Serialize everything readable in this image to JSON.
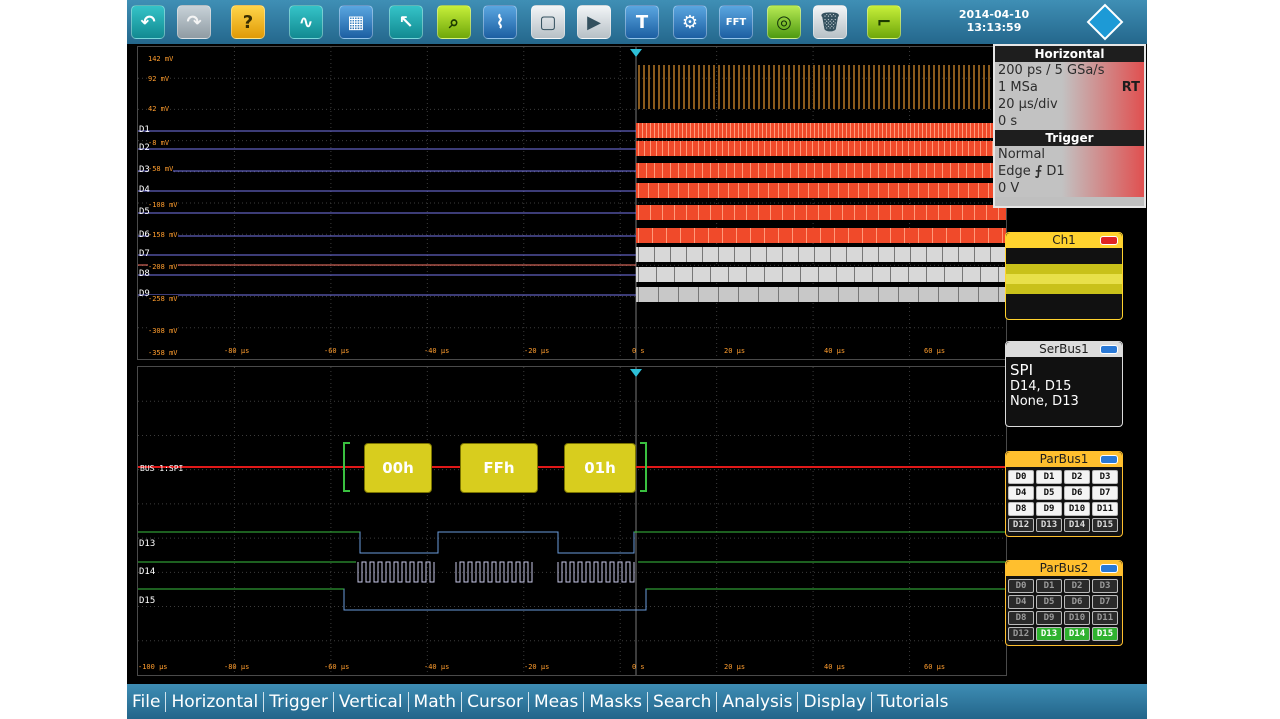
{
  "toolbar": {
    "buttons": [
      {
        "icon": "undo-arrow-icon",
        "glyph": "↶",
        "style": "tb-teal"
      },
      {
        "icon": "redo-arrow-icon",
        "glyph": "↷",
        "style": "tb-grey"
      },
      {
        "icon": "help-icon",
        "glyph": "?",
        "style": "tb-yellow"
      },
      {
        "icon": "autoset-icon",
        "glyph": "∿",
        "style": "tb-teal"
      },
      {
        "icon": "grid-layout-icon",
        "glyph": "▦",
        "style": "tb-blue"
      },
      {
        "icon": "pointer-icon",
        "glyph": "↖",
        "style": "tb-teal"
      },
      {
        "icon": "zoom-pointer-icon",
        "glyph": "⌕",
        "style": "tb-lime"
      },
      {
        "icon": "measure-icon",
        "glyph": "⌇",
        "style": "tb-blue"
      },
      {
        "icon": "window-icon",
        "glyph": "▢",
        "style": "tb-white"
      },
      {
        "icon": "flag-icon",
        "glyph": "▶",
        "style": "tb-white"
      },
      {
        "icon": "text-cursor-icon",
        "glyph": "T",
        "style": "tb-blue"
      },
      {
        "icon": "settings-window-icon",
        "glyph": "⚙",
        "style": "tb-blue"
      },
      {
        "icon": "fft-icon",
        "glyph": "FFT",
        "style": "tb-blue"
      },
      {
        "icon": "scope-icon",
        "glyph": "◎",
        "style": "tb-green"
      },
      {
        "icon": "trash-icon",
        "glyph": "🗑",
        "style": "tb-white"
      },
      {
        "icon": "waveform-icon",
        "glyph": "⌐",
        "style": "tb-lime"
      }
    ],
    "date": "2014-04-10",
    "time": "13:13:59"
  },
  "top_pane": {
    "levels": [
      "142 mV",
      "92 mV",
      "42 mV",
      "-8 mV",
      "-58 mV",
      "-108 mV",
      "-158 mV",
      "-208 mV",
      "-258 mV",
      "-308 mV",
      "-358 mV"
    ],
    "channels": [
      "D1",
      "D2",
      "D3",
      "D4",
      "D5",
      "D6",
      "D7",
      "D8",
      "D9"
    ],
    "time_ticks": [
      "-80 µs",
      "-60 µs",
      "-40 µs",
      "-20 µs",
      "0 s",
      "20 µs",
      "40 µs",
      "60 µs"
    ]
  },
  "bottom_pane": {
    "bus_label": "BUS 1:SPI",
    "bus_values": [
      "00h",
      "FFh",
      "01h"
    ],
    "channels": [
      "D13",
      "D14",
      "D15"
    ],
    "time_ticks": [
      "-100 µs",
      "-80 µs",
      "-60 µs",
      "-40 µs",
      "-20 µs",
      "0 s",
      "20 µs",
      "40 µs",
      "60 µs",
      "80 µs",
      "100 µs"
    ]
  },
  "horizontal": {
    "title": "Horizontal",
    "resolution": "200 ps / 5 GSa/s",
    "record_length": "1 MSa",
    "mode": "RT",
    "time_scale": "20 µs/div",
    "position": "0 s"
  },
  "trigger": {
    "title": "Trigger",
    "mode": "Normal",
    "type_prefix": "Edge",
    "source": "D1",
    "level": "0 V"
  },
  "ch1": {
    "title": "Ch1"
  },
  "serbus": {
    "title": "SerBus1",
    "protocol": "SPI",
    "line1": "D14, D15",
    "line2": "None, D13"
  },
  "parbus1": {
    "title": "ParBus1",
    "bits": [
      "D0",
      "D1",
      "D2",
      "D3",
      "D4",
      "D5",
      "D6",
      "D7",
      "D8",
      "D9",
      "D10",
      "D11",
      "D12",
      "D13",
      "D14",
      "D15"
    ]
  },
  "parbus2": {
    "title": "ParBus2",
    "bits": [
      "D0",
      "D1",
      "D2",
      "D3",
      "D4",
      "D5",
      "D6",
      "D7",
      "D8",
      "D9",
      "D10",
      "D11",
      "D12",
      "D13",
      "D14",
      "D15"
    ]
  },
  "menu": [
    "File",
    "Horizontal",
    "Trigger",
    "Vertical",
    "Math",
    "Cursor",
    "Meas",
    "Masks",
    "Search",
    "Analysis",
    "Display",
    "Tutorials"
  ],
  "colors": {
    "digital_active": "#ff5a36",
    "digital_idle": "#6f6fd6",
    "bus_box": "#d8cd1e",
    "bus_line": "#e01818",
    "grid": "#3a3a3a",
    "accent": "#2a79a3",
    "ch1": "#ffd22e"
  }
}
